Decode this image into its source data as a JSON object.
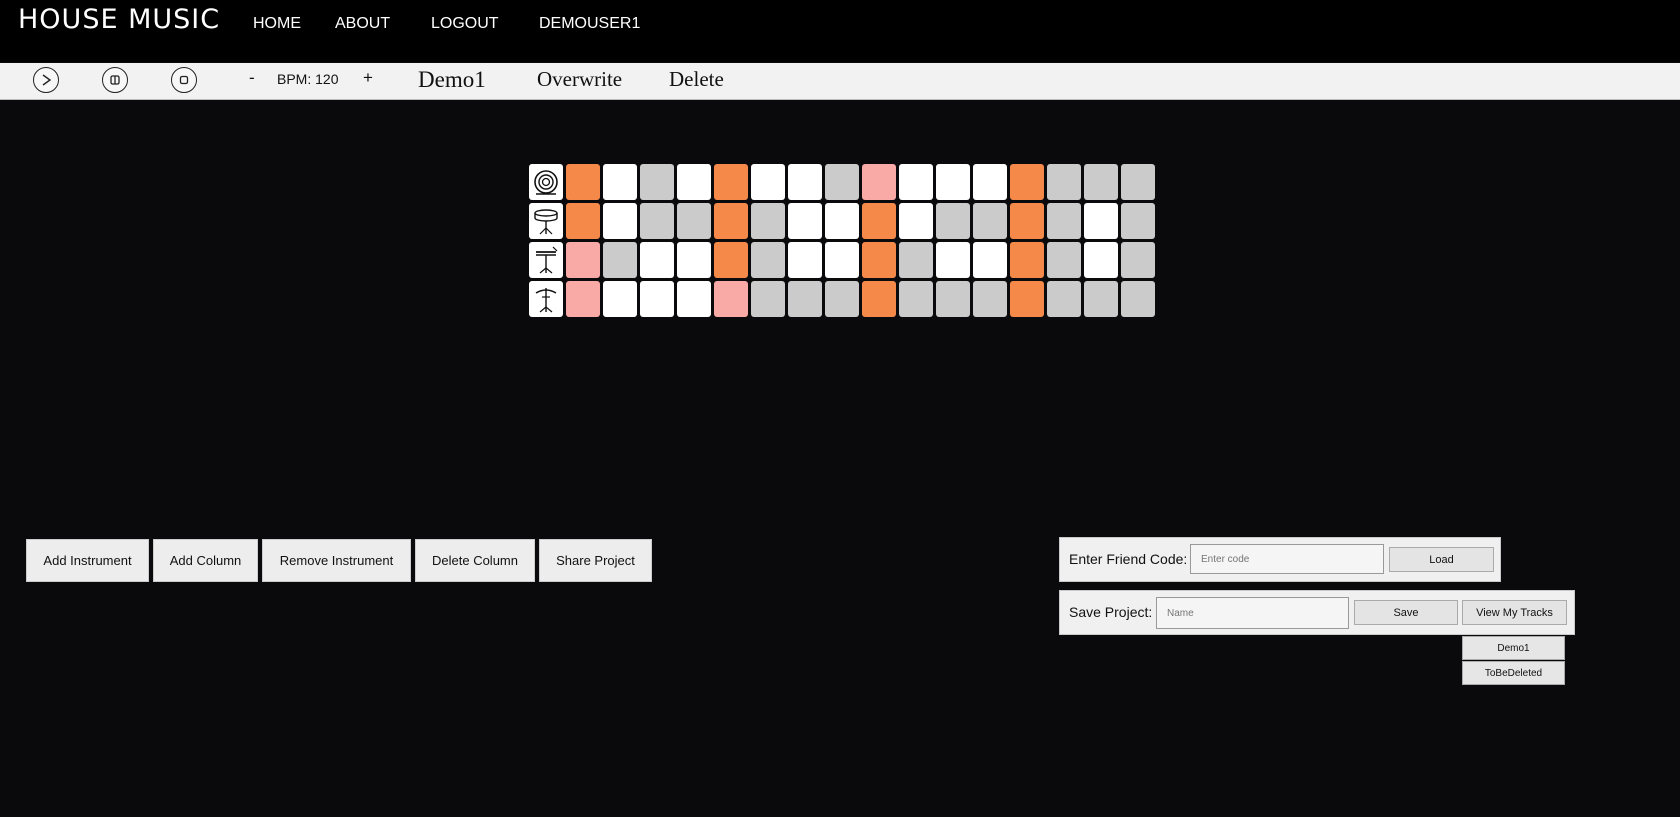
{
  "nav": {
    "brand": "HOUSE MUSIC",
    "links": [
      "HOME",
      "ABOUT",
      "LOGOUT",
      "DEMOUSER1"
    ]
  },
  "toolbar": {
    "play_icon": "play-icon",
    "pause_icon": "pause-icon",
    "stop_icon": "stop-icon",
    "minus": "-",
    "bpm": "BPM: 120",
    "plus": "+",
    "project_name": "Demo1",
    "overwrite": "Overwrite",
    "delete": "Delete"
  },
  "sequencer": {
    "instruments": [
      "kick-drum-icon",
      "snare-drum-icon",
      "hi-hat-icon",
      "cymbal-icon"
    ],
    "colors": {
      "off_white": "#ffffff",
      "off_gray": "#cbcbcb",
      "on": "#f5894a",
      "soft": "#f9a9a6"
    },
    "rows": [
      [
        "on",
        "w",
        "g",
        "w",
        "on",
        "w",
        "w",
        "g",
        "soft",
        "w",
        "w",
        "w",
        "on",
        "g",
        "g",
        "g"
      ],
      [
        "on",
        "w",
        "g",
        "g",
        "on",
        "g",
        "w",
        "w",
        "on",
        "w",
        "g",
        "g",
        "on",
        "g",
        "w",
        "g"
      ],
      [
        "soft",
        "g",
        "w",
        "w",
        "on",
        "g",
        "w",
        "w",
        "on",
        "g",
        "w",
        "w",
        "on",
        "g",
        "w",
        "g"
      ],
      [
        "soft",
        "w",
        "w",
        "w",
        "soft",
        "g",
        "g",
        "g",
        "on",
        "g",
        "g",
        "g",
        "on",
        "g",
        "g",
        "g"
      ]
    ]
  },
  "actions": {
    "add_instrument": "Add Instrument",
    "add_column": "Add Column",
    "remove_instrument": "Remove Instrument",
    "delete_column": "Delete Column",
    "share_project": "Share Project"
  },
  "friend": {
    "label": "Enter Friend Code:",
    "placeholder": "Enter code",
    "load": "Load"
  },
  "save": {
    "label": "Save Project:",
    "placeholder": "Name",
    "save": "Save",
    "view_tracks": "View My Tracks",
    "tracks": [
      "Demo1",
      "ToBeDeleted"
    ]
  }
}
